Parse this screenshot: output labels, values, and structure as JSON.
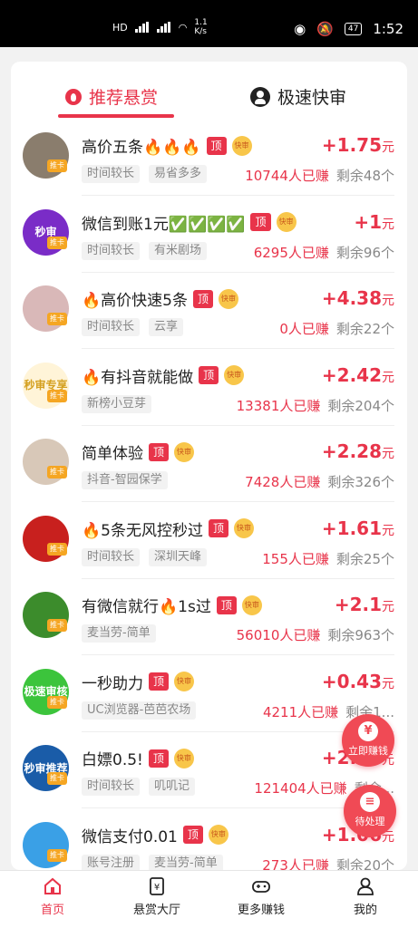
{
  "status": {
    "net": "HD",
    "speed_value": "1.1",
    "speed_unit": "K/s",
    "battery": "47",
    "time": "1:52"
  },
  "tabs": [
    {
      "label": "推荐悬赏",
      "icon": "flame-icon",
      "active": true
    },
    {
      "label": "极速快审",
      "icon": "user-icon",
      "active": false
    }
  ],
  "badge_top": "顶",
  "badge_fast": "快审",
  "avatar_badge": "推卡",
  "tasks": [
    {
      "title": "高价五条🔥🔥🔥",
      "reward": "+1.75",
      "unit": "元",
      "tags": [
        "时间较长",
        "易省多多"
      ],
      "earned": "10744人已赚",
      "left": "剩余48个",
      "avatar_color": "#8a7d6d",
      "avatar_text": ""
    },
    {
      "title": "微信到账1元✅✅✅✅",
      "reward": "+1",
      "unit": "元",
      "tags": [
        "时间较长",
        "有米剧场"
      ],
      "earned": "6295人已赚",
      "left": "剩余96个",
      "avatar_color": "#7a2cc7",
      "avatar_text": "秒审"
    },
    {
      "title": "🔥高价快速5条",
      "reward": "+4.38",
      "unit": "元",
      "tags": [
        "时间较长",
        "云享"
      ],
      "earned": "0人已赚",
      "left": "剩余22个",
      "avatar_color": "#d9b8b8",
      "avatar_text": ""
    },
    {
      "title": "🔥有抖音就能做",
      "reward": "+2.42",
      "unit": "元",
      "tags": [
        "新榜小豆芽"
      ],
      "earned": "13381人已赚",
      "left": "剩余204个",
      "avatar_color": "#fff4d8",
      "avatar_text": "秒审专享"
    },
    {
      "title": "简单体验",
      "reward": "+2.28",
      "unit": "元",
      "tags": [
        "抖音-智园保学"
      ],
      "earned": "7428人已赚",
      "left": "剩余326个",
      "avatar_color": "#d8c8b8",
      "avatar_text": ""
    },
    {
      "title": "🔥5条无风控秒过",
      "reward": "+1.61",
      "unit": "元",
      "tags": [
        "时间较长",
        "深圳天峰"
      ],
      "earned": "155人已赚",
      "left": "剩余25个",
      "avatar_color": "#c8201e",
      "avatar_text": ""
    },
    {
      "title": "有微信就行🔥1s过",
      "reward": "+2.1",
      "unit": "元",
      "tags": [
        "麦当劳-简单"
      ],
      "earned": "56010人已赚",
      "left": "剩余963个",
      "avatar_color": "#3c8c2c",
      "avatar_text": ""
    },
    {
      "title": "一秒助力",
      "reward": "+0.43",
      "unit": "元",
      "tags": [
        "UC浏览器-芭芭农场"
      ],
      "earned": "4211人已赚",
      "left": "剩余1...",
      "avatar_color": "#3cc43c",
      "avatar_text": "极速审核"
    },
    {
      "title": "白嫖0.5!",
      "reward": "+2.33",
      "unit": "元",
      "tags": [
        "时间较长",
        "叽叽记"
      ],
      "earned": "121404人已赚",
      "left": "剩余...",
      "avatar_color": "#1a5ca8",
      "avatar_text": "秒审推荐"
    },
    {
      "title": "微信支付0.01",
      "reward": "+1.06",
      "unit": "元",
      "tags": [
        "账号注册",
        "麦当劳-简单"
      ],
      "earned": "273人已赚",
      "left": "剩余20个",
      "avatar_color": "#3aa0e6",
      "avatar_text": ""
    }
  ],
  "fabs": {
    "earn": "立即赚钱",
    "earn_icon": "¥",
    "pending": "待处理",
    "pending_icon": "≡"
  },
  "tabbar": [
    {
      "label": "首页",
      "icon": "home-icon",
      "active": true
    },
    {
      "label": "悬赏大厅",
      "icon": "reward-hall-icon",
      "active": false
    },
    {
      "label": "更多赚钱",
      "icon": "gamepad-icon",
      "active": false
    },
    {
      "label": "我的",
      "icon": "profile-icon",
      "active": false
    }
  ]
}
